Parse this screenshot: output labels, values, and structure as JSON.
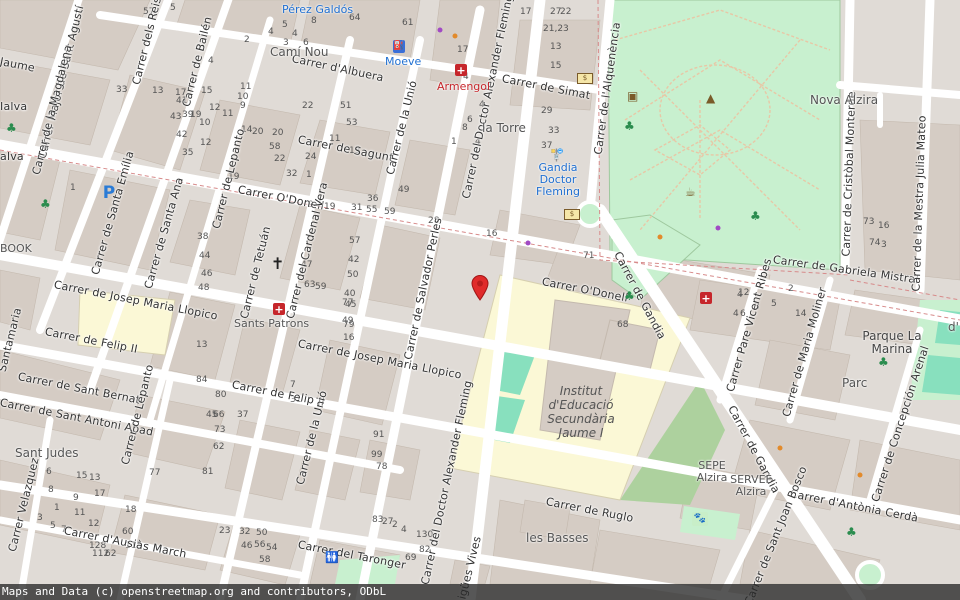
{
  "attribution": "Maps and Data (c) openstreetmap.org and contributors, ODbL",
  "colors": {
    "land": "#e0dbd6",
    "building": "#d5ccc4",
    "road": "#ffffff",
    "park": "#c8f0cf",
    "parkDark": "#add19e",
    "school": "#fbf8d6",
    "pitch": "#88e0be",
    "marker": "#e02b2b"
  },
  "streets": [
    {
      "name": "Carrer de Simat"
    },
    {
      "name": "Carrer d'Albuera"
    },
    {
      "name": "Carrer de Sagunt"
    },
    {
      "name": "Carrer O'Donell"
    },
    {
      "name": "Carrer O'Donell"
    },
    {
      "name": "Carrer de Gabriela Mistral"
    },
    {
      "name": "Carrer de Josep Maria Llopico"
    },
    {
      "name": "Carrer de Josep Maria Llopico"
    },
    {
      "name": "Carrer de Felip II"
    },
    {
      "name": "Carrer de Felip II"
    },
    {
      "name": "Carrer de Sant Bernat"
    },
    {
      "name": "Carrer de Sant Antoni Abad"
    },
    {
      "name": "Carrer d'Ausiàs March"
    },
    {
      "name": "Carrer del Taronger"
    },
    {
      "name": "Carrer de Ruglo"
    },
    {
      "name": "Carrer d'Antònia Cerdà"
    },
    {
      "name": "Carrer Major de Sant Agustí"
    },
    {
      "name": "Carrer de la Magdalena"
    },
    {
      "name": "Carrer dels Reis Católics"
    },
    {
      "name": "Carrer de Bailén"
    },
    {
      "name": "Carrer de Lepanto"
    },
    {
      "name": "Carrer de Lepanto"
    },
    {
      "name": "Carrer de Santa Emília"
    },
    {
      "name": "Carrer de Santa Ana"
    },
    {
      "name": "Carrer de Tetuán"
    },
    {
      "name": "Carrer del Cardenal Vera"
    },
    {
      "name": "Carrer de la Unió"
    },
    {
      "name": "Carrer de la Unió"
    },
    {
      "name": "Carrer de Salvador Perles"
    },
    {
      "name": "Carrer del Doctor Alexander Fleming"
    },
    {
      "name": "Carrer del Doctor Alexander Fleming"
    },
    {
      "name": "Carrer de l'Alquenència"
    },
    {
      "name": "Carrer de Cristòbal Monterde"
    },
    {
      "name": "Carrer de la Mestra Julia Mateo"
    },
    {
      "name": "Carrer de Gandia"
    },
    {
      "name": "Carrer de Gandia"
    },
    {
      "name": "Carrer Pare Vicent Ribes"
    },
    {
      "name": "Carrer de Maria Moliner"
    },
    {
      "name": "Carrer de Concepción Arenal"
    },
    {
      "name": "Carrer de Sant Joan Bosco"
    },
    {
      "name": "Carrer Velazquez"
    },
    {
      "name": "Aigües Vives"
    },
    {
      "name": "Jaume"
    },
    {
      "name": "Santamaria"
    },
    {
      "name": "Ialva"
    },
    {
      "name": "alva"
    }
  ],
  "pois": [
    {
      "name": "Pérez Galdós"
    },
    {
      "name": "Camí Nou"
    },
    {
      "name": "Moeve"
    },
    {
      "name": "Armengol"
    },
    {
      "name": "la Torre"
    },
    {
      "name": "Gandia Doctor Fleming"
    },
    {
      "name": "Nova Alzira"
    },
    {
      "name": "BOOK"
    },
    {
      "name": "Sants Patrons"
    },
    {
      "name": "Parque La Marina"
    },
    {
      "name": "Parc"
    },
    {
      "name": "Institut d'Educació Secundària Jaume I"
    },
    {
      "name": "SEPE Alzira"
    },
    {
      "name": "SERVEF Alzira"
    },
    {
      "name": "les Basses"
    },
    {
      "name": "Sant Judes"
    },
    {
      "name": "d'"
    }
  ],
  "house_numbers": [
    "57",
    "5",
    "64",
    "61",
    "17",
    "27",
    "22",
    "5",
    "4",
    "3",
    "6",
    "8",
    "4",
    "2",
    "4",
    "11",
    "10",
    "9",
    "21,23",
    "13",
    "15",
    "33",
    "43",
    "42",
    "35",
    "39",
    "41",
    "1",
    "14",
    "20",
    "20",
    "17",
    "4",
    "6",
    "4",
    "4",
    "8",
    "1",
    "19",
    "17",
    "15",
    "13",
    "12",
    "11",
    "12",
    "10",
    "19",
    "29",
    "37",
    "33",
    "11",
    "13",
    "1",
    "24",
    "22",
    "32",
    "36",
    "55",
    "59",
    "49",
    "28",
    "31",
    "9",
    "19",
    "16",
    "58",
    "51",
    "53",
    "22",
    "38",
    "44",
    "46",
    "48",
    "57",
    "59",
    "63",
    "47",
    "49",
    "45",
    "40",
    "42",
    "50",
    "77",
    "79",
    "16",
    "68",
    "71",
    "73",
    "74",
    "3",
    "4",
    "6",
    "4",
    "12",
    "2",
    "3",
    "5",
    "14",
    "16",
    "13",
    "7",
    "31",
    "37",
    "66",
    "73",
    "62",
    "81",
    "91",
    "99",
    "78",
    "80",
    "84",
    "45",
    "77",
    "83",
    "27",
    "2",
    "4",
    "6",
    "8",
    "1",
    "3",
    "5",
    "7",
    "9",
    "11",
    "12",
    "13",
    "15",
    "17",
    "18",
    "23",
    "32",
    "46",
    "50",
    "56",
    "58",
    "54",
    "60",
    "62",
    "112",
    "115",
    "128",
    "130",
    "82",
    "69",
    "96",
    "2",
    "98"
  ]
}
